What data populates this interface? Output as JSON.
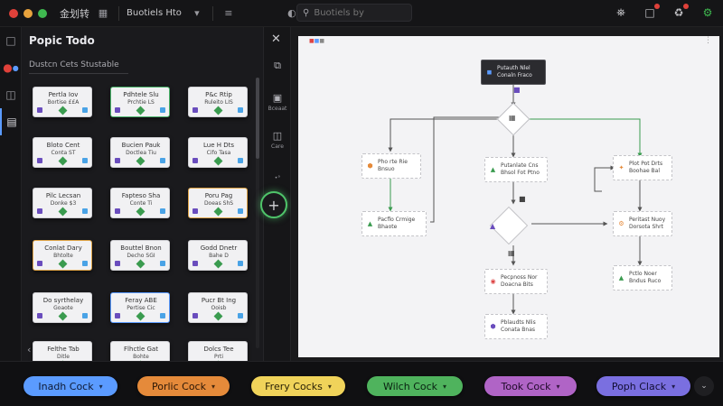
{
  "app": {
    "menu_title": "金划转",
    "tab_label": "Buotiels Hto",
    "search": {
      "value": "",
      "placeholder": "Buotiels by"
    }
  },
  "colors": {
    "close": "#e0413a",
    "minimize": "#e8a33d",
    "maximize": "#3fb950",
    "accent_green": "#4fc46a",
    "accent_blue": "#5b9bff"
  },
  "icons": {
    "grid": "grid-icon",
    "tune": "sliders-icon",
    "chevron": "chevron-down-icon",
    "theme": "theme-icon",
    "search": "search-icon",
    "shield": "shield-icon",
    "note": "note-icon",
    "recycle": "recycle-icon",
    "settings": "gear-icon"
  },
  "panel": {
    "title": "Popic Todo",
    "subtitle": "Dustcn Cets Stustable",
    "cards": [
      {
        "t": "Pertla Iov",
        "s": "Bortise ££A",
        "style": "plain"
      },
      {
        "t": "Pdhtele Slu",
        "s": "Prchtie LS",
        "style": "green"
      },
      {
        "t": "P&c Rtip",
        "s": "Ruleito LIS",
        "style": "plain"
      },
      {
        "t": "Bloto Cent",
        "s": "Conta ST",
        "style": "plain"
      },
      {
        "t": "Bucien Pauk",
        "s": "Doctlea Tiu",
        "style": "plain"
      },
      {
        "t": "Lue H Dts",
        "s": "Cifo Tasa",
        "style": "plain"
      },
      {
        "t": "Pilc Lecsan",
        "s": "Donke $3",
        "style": "plain"
      },
      {
        "t": "Fapteso Sha",
        "s": "Conte Ti",
        "style": "plain"
      },
      {
        "t": "Poru Pag",
        "s": "Doeas ShS",
        "style": "orange"
      },
      {
        "t": "Conlat Dary",
        "s": "Bhtolte",
        "style": "orange"
      },
      {
        "t": "Bouttel Bnon",
        "s": "Decho SGI",
        "style": "plain"
      },
      {
        "t": "Godd Dnetr",
        "s": "Bahe D",
        "style": "plain"
      },
      {
        "t": "Do syrthelay",
        "s": "Goaote",
        "style": "plain"
      },
      {
        "t": "Feray ABE",
        "s": "Pertise Cic",
        "style": "blue"
      },
      {
        "t": "Pucr Bt Ing",
        "s": "Ooisb",
        "style": "plain"
      },
      {
        "t": "Felthe Tab",
        "s": "Ditle",
        "style": "plain"
      },
      {
        "t": "Flhctle Gat",
        "s": "Bohte",
        "style": "plain"
      },
      {
        "t": "Dolcs Tee",
        "s": "Prti",
        "style": "plain"
      }
    ]
  },
  "strip": {
    "tools": [
      {
        "label": ""
      },
      {
        "label": "Bceaat"
      },
      {
        "label": "Care"
      },
      {
        "label": "•°"
      }
    ]
  },
  "canvas": {
    "nodes": {
      "start": {
        "l1": "Putauth Nlel",
        "l2": "Conaln Fraco"
      },
      "left1": {
        "l1": "Pho rte Rie",
        "l2": "Bnsuo"
      },
      "mid1": {
        "l1": "Putanlate Cns",
        "l2": "Bhsol Fot Ptno"
      },
      "right1": {
        "l1": "Plot Pot Drts",
        "l2": "Boohae Bal"
      },
      "left2": {
        "l1": "Pacflo Crmige",
        "l2": "Bhaote"
      },
      "right2": {
        "l1": "Peritast Nuoy",
        "l2": "Dorsota Shrt"
      },
      "mid2": {
        "l1": "Pecpnoss Nor",
        "l2": "Doacna Bits"
      },
      "right3": {
        "l1": "Pctlo Noer",
        "l2": "Bndus Ruco"
      },
      "mid3": {
        "l1": "Pblaudts Nlis",
        "l2": "Conata Bnas"
      }
    }
  },
  "toolbar": {
    "buttons": [
      {
        "label": "Inadh Cock",
        "bg": "#5b9bff",
        "fg": "#0e1a33"
      },
      {
        "label": "Porlic Cock",
        "bg": "#e58a3a",
        "fg": "#2a1606"
      },
      {
        "label": "Frery Cocks",
        "bg": "#f0d35a",
        "fg": "#2a2206"
      },
      {
        "label": "Wilch Cock",
        "bg": "#4fb35d",
        "fg": "#082010"
      },
      {
        "label": "Took Cock",
        "bg": "#b064c6",
        "fg": "#1f0a29"
      },
      {
        "label": "Poph Clack",
        "bg": "#7a6fe0",
        "fg": "#120e33"
      }
    ]
  }
}
